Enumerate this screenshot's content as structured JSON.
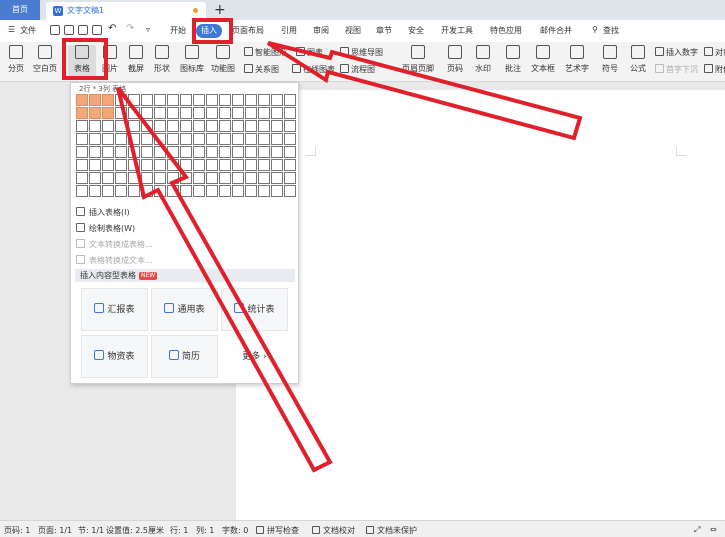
{
  "tabbar": {
    "home": "首页",
    "doc_title": "文字文稿1",
    "new_tab": "+"
  },
  "menubar": {
    "file": "文件",
    "items": [
      "开始",
      "插入",
      "页面布局",
      "引用",
      "审阅",
      "视图",
      "章节",
      "安全",
      "开发工具",
      "特色应用",
      "邮件合并"
    ],
    "search": "查找"
  },
  "ribbon": {
    "buttons": [
      "分页",
      "空白页",
      "表格",
      "图片",
      "截屏",
      "形状",
      "图标库",
      "功能图"
    ],
    "smartgraphic": "智能图形",
    "chart": "图表",
    "relation": "关系图",
    "online_chart": "在线图表",
    "mindmap": "思维导图",
    "flowchart": "流程图",
    "buttons2": [
      "页眉页脚",
      "页码",
      "水印",
      "批注",
      "文本框",
      "艺术字",
      "符号",
      "公式"
    ],
    "insert_number": "插入数字",
    "object": "对象",
    "first_drop": "首字下沉",
    "attach": "附件"
  },
  "dropdown": {
    "size_label": "2行 * 3列 表格",
    "grid": {
      "rows": 8,
      "cols": 17,
      "sel_rows": 2,
      "sel_cols": 3
    },
    "insert_table": "插入表格(I)",
    "draw_table": "绘制表格(W)",
    "text_to_table": "文本转换成表格...",
    "table_to_text": "表格转换成文本...",
    "section": "插入内容型表格",
    "badge": "NEW",
    "cards": [
      "汇报表",
      "通用表",
      "统计表",
      "物资表",
      "简历",
      "更多"
    ]
  },
  "statusbar": {
    "page_num": "页码: 1",
    "pages": "页面: 1/1",
    "section": "节: 1/1",
    "setting": "设置值: 2.5厘米",
    "row": "行: 1",
    "col": "列: 1",
    "words": "字数: 0",
    "spell": "拼写检查",
    "proof": "文档校对",
    "protect": "文档未保护"
  },
  "colors": {
    "accent": "#3c78d8",
    "highlight": "#e0202a",
    "cell_sel": "#f3a77a"
  }
}
